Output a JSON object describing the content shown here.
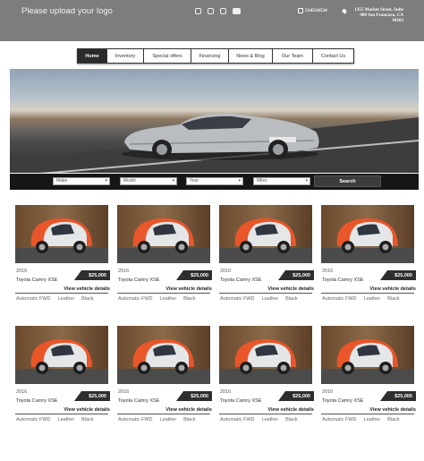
{
  "header": {
    "logo_text": "Please upload your logo",
    "social_icons": [
      "facebook-icon",
      "twitter-icon",
      "instagram-icon",
      "youtube-icon"
    ],
    "phone": "534534534",
    "address_line1": "1355 Market Street, Suite",
    "address_line2": "900 San Francisco, CA",
    "address_line3": "94103"
  },
  "nav": {
    "items": [
      {
        "label": "Home",
        "active": true
      },
      {
        "label": "Inventory"
      },
      {
        "label": "Special offers"
      },
      {
        "label": "Financing"
      },
      {
        "label": "News & Blog"
      },
      {
        "label": "Our Team"
      },
      {
        "label": "Contact Us"
      }
    ]
  },
  "search": {
    "make": "Make",
    "model": "Model",
    "year": "Year",
    "miles": "Miles",
    "button": "Search"
  },
  "listings": [
    {
      "year": "2016",
      "price": "$25,000",
      "title": "Toyota Camry XSE",
      "link": "View vehicle details",
      "drive": "Automatic FWD",
      "interior": "Leather",
      "color": "Black"
    },
    {
      "year": "2016",
      "price": "$25,000",
      "title": "Toyota Camry XSE",
      "link": "View vehicle details",
      "drive": "Automatic FWD",
      "interior": "Leather",
      "color": "Black"
    },
    {
      "year": "2016",
      "price": "$25,000",
      "title": "Toyota Camry XSE",
      "link": "View vehicle details",
      "drive": "Automatic FWD",
      "interior": "Leather",
      "color": "Black"
    },
    {
      "year": "2016",
      "price": "$25,000",
      "title": "Toyota Camry XSE",
      "link": "View vehicle details",
      "drive": "Automatic FWD",
      "interior": "Leather",
      "color": "Black"
    },
    {
      "year": "2016",
      "price": "$25,000",
      "title": "Toyota Camry XSE",
      "link": "View vehicle details",
      "drive": "Automatic FWD",
      "interior": "Leather",
      "color": "Black"
    },
    {
      "year": "2016",
      "price": "$25,000",
      "title": "Toyota Camry XSE",
      "link": "View vehicle details",
      "drive": "Automatic FWD",
      "interior": "Leather",
      "color": "Black"
    },
    {
      "year": "2016",
      "price": "$25,000",
      "title": "Toyota Camry XSE",
      "link": "View vehicle details",
      "drive": "Automatic FWD",
      "interior": "Leather",
      "color": "Black"
    },
    {
      "year": "2016",
      "price": "$25,000",
      "title": "Toyota Camry XSE",
      "link": "View vehicle details",
      "drive": "Automatic FWD",
      "interior": "Leather",
      "color": "Black"
    }
  ],
  "colors": {
    "header_bg": "#7d7d7d",
    "nav_active": "#2b2b2b",
    "search_bar": "#161616",
    "price_badge": "#2e2e2e",
    "car_accent": "#e8562a"
  }
}
